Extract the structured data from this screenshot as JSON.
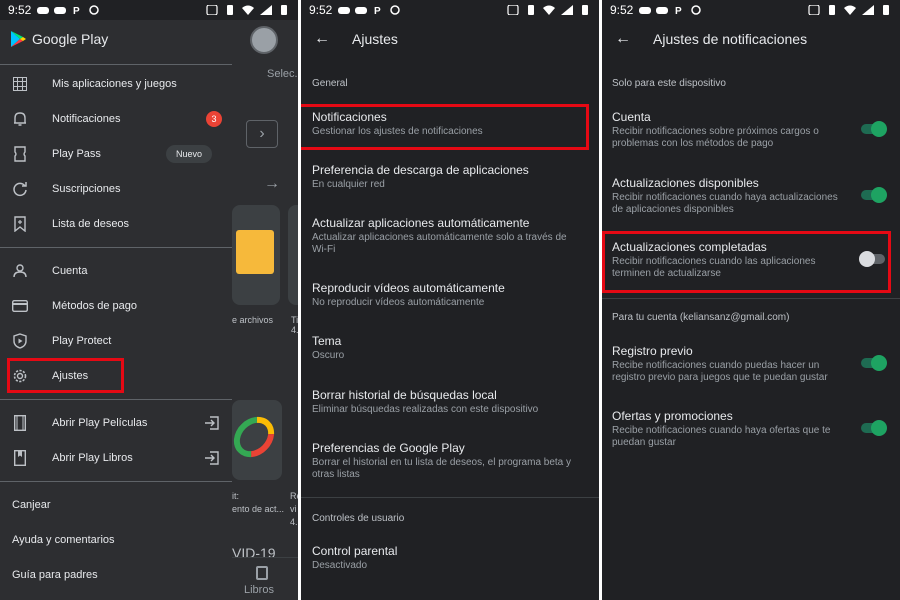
{
  "status": {
    "time": "9:52"
  },
  "drawer": {
    "app_name": "Google Play",
    "items": [
      {
        "label": "Mis aplicaciones y juegos",
        "icon": "apps-grid-icon"
      },
      {
        "label": "Notificaciones",
        "icon": "bell-icon",
        "badge": "3"
      },
      {
        "label": "Play Pass",
        "icon": "ticket-icon",
        "pill": "Nuevo"
      },
      {
        "label": "Suscripciones",
        "icon": "refresh-icon"
      },
      {
        "label": "Lista de deseos",
        "icon": "bookmark-icon"
      },
      {
        "label": "Cuenta",
        "icon": "person-icon"
      },
      {
        "label": "Métodos de pago",
        "icon": "credit-card-icon"
      },
      {
        "label": "Play Protect",
        "icon": "shield-play-icon"
      },
      {
        "label": "Ajustes",
        "icon": "gear-icon"
      },
      {
        "label": "Abrir Play Películas",
        "icon": "film-icon"
      },
      {
        "label": "Abrir Play Libros",
        "icon": "book-icon"
      }
    ],
    "plain_items": [
      "Canjear",
      "Ayuda y comentarios",
      "Guía para padres"
    ]
  },
  "background_app": {
    "tab": "Selec.",
    "label1": "e archivos",
    "label2": "Ti",
    "label2b": "4.",
    "label3a": "it:",
    "label3b": "ento de act...",
    "label4a": "Re",
    "label4b": "vi",
    "label4c": "4.",
    "covid": "VID-19",
    "nav_libros": "Libros"
  },
  "settings": {
    "title": "Ajustes",
    "section_general": "General",
    "rows": [
      {
        "title": "Notificaciones",
        "subtitle": "Gestionar los ajustes de notificaciones"
      },
      {
        "title": "Preferencia de descarga de aplicaciones",
        "subtitle": "En cualquier red"
      },
      {
        "title": "Actualizar aplicaciones automáticamente",
        "subtitle": "Actualizar aplicaciones automáticamente solo a través de Wi-Fi"
      },
      {
        "title": "Reproducir vídeos automáticamente",
        "subtitle": "No reproducir vídeos automáticamente"
      },
      {
        "title": "Tema",
        "subtitle": "Oscuro"
      },
      {
        "title": "Borrar historial de búsquedas local",
        "subtitle": "Eliminar búsquedas realizadas con este dispositivo"
      },
      {
        "title": "Preferencias de Google Play",
        "subtitle": "Borrar el historial en tu lista de deseos, el programa beta y otras listas"
      }
    ],
    "section_user": "Controles de usuario",
    "parental": {
      "title": "Control parental",
      "subtitle": "Desactivado"
    }
  },
  "notifications": {
    "title": "Ajustes de notificaciones",
    "section_device": "Solo para este dispositivo",
    "device_rows": [
      {
        "title": "Cuenta",
        "subtitle": "Recibir notificaciones sobre próximos cargos o problemas con los métodos de pago",
        "on": true
      },
      {
        "title": "Actualizaciones disponibles",
        "subtitle": "Recibir notificaciones cuando haya actualizaciones de aplicaciones disponibles",
        "on": true
      },
      {
        "title": "Actualizaciones completadas",
        "subtitle": "Recibir notificaciones cuando las aplicaciones terminen de actualizarse",
        "on": false
      }
    ],
    "section_account": "Para tu cuenta (keliansanz@gmail.com)",
    "account_rows": [
      {
        "title": "Registro previo",
        "subtitle": "Recibe notificaciones cuando puedas hacer un registro previo para juegos que te puedan gustar",
        "on": true
      },
      {
        "title": "Ofertas y promociones",
        "subtitle": "Recibe notificaciones cuando haya ofertas que te puedan gustar",
        "on": true
      }
    ]
  },
  "colors": {
    "highlight": "#e50914",
    "toggle_on": "#1ea362",
    "badge": "#ea4335"
  }
}
